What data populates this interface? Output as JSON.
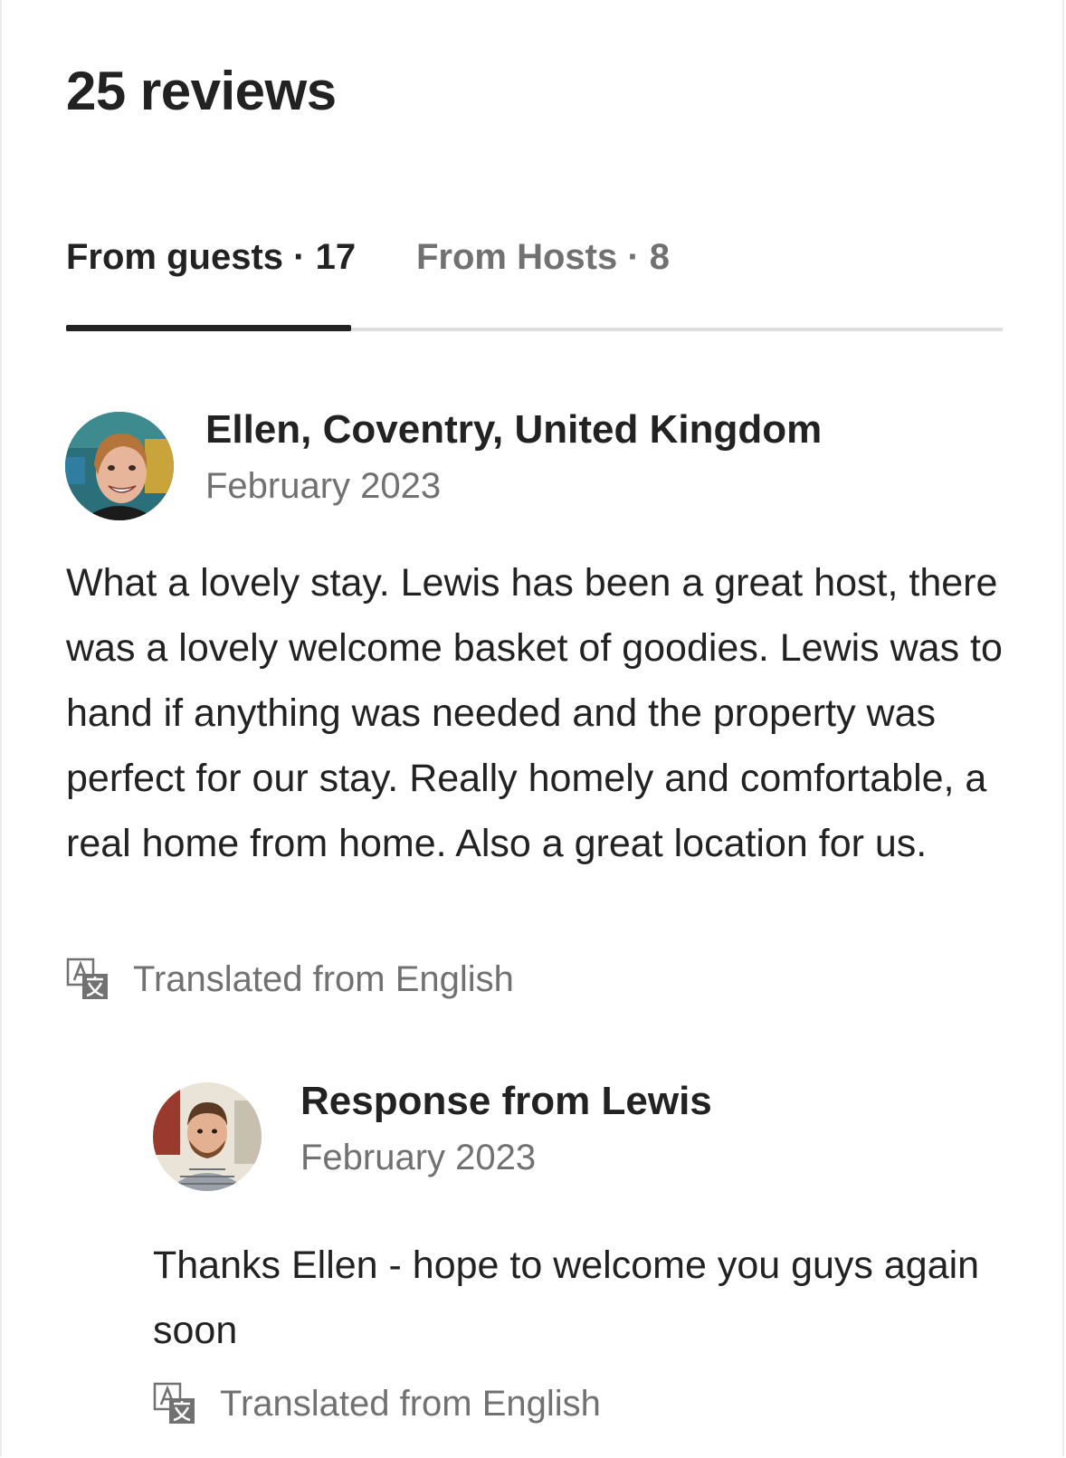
{
  "header": {
    "title": "25 reviews"
  },
  "tabs": [
    {
      "label": "From guests · 17",
      "active": true
    },
    {
      "label": "From Hosts · 8",
      "active": false
    }
  ],
  "review": {
    "author": "Ellen, Coventry, United Kingdom",
    "date": "February 2023",
    "text": "What a lovely stay. Lewis has been a great host, there was a lovely welcome basket of goodies. Lewis was to hand if anything was needed and the property was perfect for our stay. Really homely and comfortable, a real home from home. Also a great location for us.",
    "translated_label": "Translated from English",
    "avatar_icon": "user-avatar-ellen"
  },
  "response": {
    "author": "Response from Lewis",
    "date": "February 2023",
    "text": "Thanks Ellen - hope to welcome you guys again soon",
    "translated_label": "Translated from English",
    "avatar_icon": "user-avatar-lewis"
  },
  "colors": {
    "text_primary": "#222222",
    "text_secondary": "#717171",
    "divider": "#dddddd"
  }
}
